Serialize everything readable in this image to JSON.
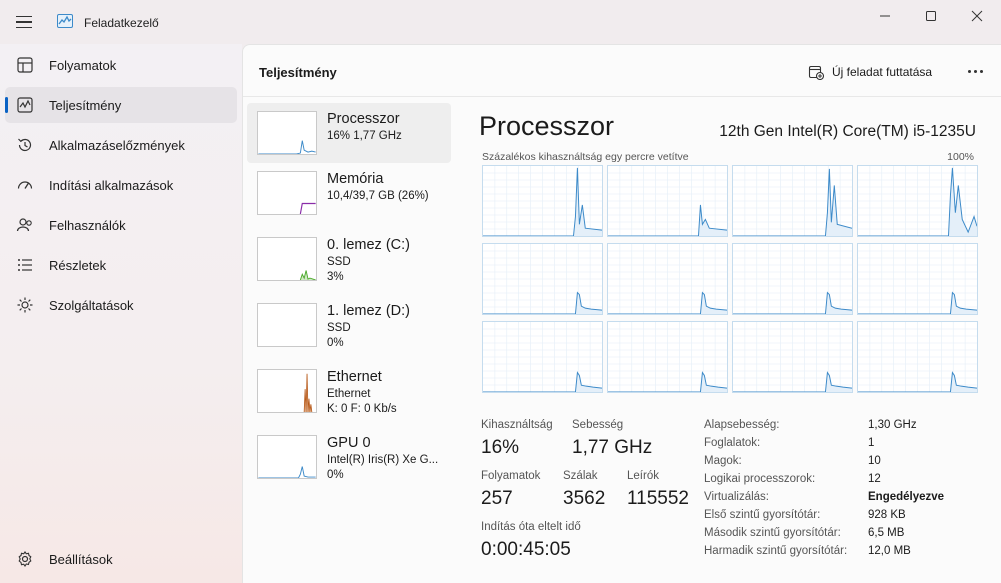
{
  "app": {
    "title": "Feladatkezelő"
  },
  "nav": {
    "items": [
      {
        "label": "Folyamatok",
        "icon": "processes-icon"
      },
      {
        "label": "Teljesítmény",
        "icon": "performance-icon",
        "active": true
      },
      {
        "label": "Alkalmazáselőzmények",
        "icon": "history-icon"
      },
      {
        "label": "Indítási alkalmazások",
        "icon": "startup-icon"
      },
      {
        "label": "Felhasználók",
        "icon": "users-icon"
      },
      {
        "label": "Részletek",
        "icon": "details-icon"
      },
      {
        "label": "Szolgáltatások",
        "icon": "services-icon"
      }
    ],
    "settings": {
      "label": "Beállítások",
      "icon": "gear-icon"
    }
  },
  "header": {
    "title": "Teljesítmény",
    "run_task_label": "Új feladat futtatása"
  },
  "devices": [
    {
      "name": "Processzor",
      "line1": "16%  1,77 GHz",
      "line2": ""
    },
    {
      "name": "Memória",
      "line1": "10,4/39,7 GB (26%)",
      "line2": ""
    },
    {
      "name": "0. lemez (C:)",
      "line1": "SSD",
      "line2": "3%"
    },
    {
      "name": "1. lemez (D:)",
      "line1": "SSD",
      "line2": "0%"
    },
    {
      "name": "Ethernet",
      "line1": "Ethernet",
      "line2": "K: 0  F: 0 Kb/s"
    },
    {
      "name": "GPU 0",
      "line1": "Intel(R) Iris(R) Xe G...",
      "line2": "0%"
    }
  ],
  "detail": {
    "title": "Processzor",
    "model": "12th Gen Intel(R) Core(TM) i5-1235U",
    "graph_caption": "Százalékos kihasználtság egy percre vetítve",
    "graph_max": "100%",
    "stats": {
      "utilization": {
        "label": "Kihasználtság",
        "value": "16%"
      },
      "speed": {
        "label": "Sebesség",
        "value": "1,77 GHz"
      },
      "processes": {
        "label": "Folyamatok",
        "value": "257"
      },
      "threads": {
        "label": "Szálak",
        "value": "3562"
      },
      "handles": {
        "label": "Leírók",
        "value": "115552"
      },
      "uptime": {
        "label": "Indítás óta eltelt idő",
        "value": "0:00:45:05"
      }
    },
    "specs": [
      {
        "k": "Alapsebesség:",
        "v": "1,30 GHz"
      },
      {
        "k": "Foglalatok:",
        "v": "1"
      },
      {
        "k": "Magok:",
        "v": "10"
      },
      {
        "k": "Logikai processzorok:",
        "v": "12"
      },
      {
        "k": "Virtualizálás:",
        "v": "Engedélyezve",
        "bold": true
      },
      {
        "k": "Első szintű gyorsítótár:",
        "v": "928 KB"
      },
      {
        "k": "Második szintű gyorsítótár:",
        "v": "6,5 MB"
      },
      {
        "k": "Harmadik szintű gyorsítótár:",
        "v": "12,0 MB"
      }
    ]
  },
  "colors": {
    "cpu": "#3c8ac9",
    "memory": "#8a2da8",
    "disk": "#4caa2c",
    "network": "#b85a1a",
    "accent": "#0a62c4"
  }
}
